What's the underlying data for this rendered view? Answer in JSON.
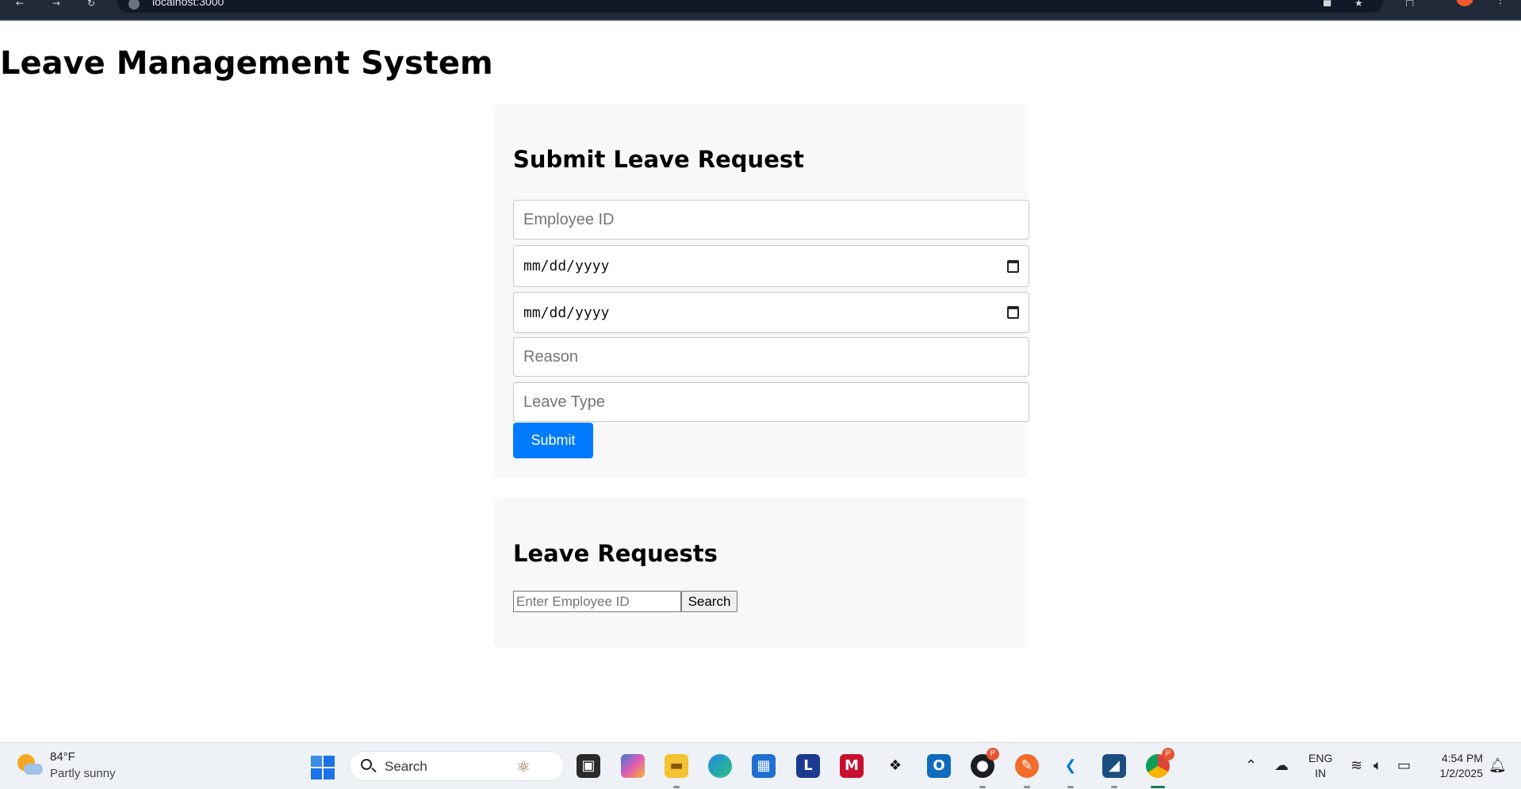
{
  "browser": {
    "url": "localhost:3000"
  },
  "page": {
    "title": "Leave Management System"
  },
  "submit_form": {
    "heading": "Submit Leave Request",
    "employee_id_placeholder": "Employee ID",
    "start_date_placeholder": "mm/dd/yyyy",
    "end_date_placeholder": "mm/dd/yyyy",
    "reason_placeholder": "Reason",
    "leave_type_placeholder": "Leave Type",
    "submit_label": "Submit"
  },
  "requests": {
    "heading": "Leave Requests",
    "search_placeholder": "Enter Employee ID",
    "search_label": "Search"
  },
  "taskbar": {
    "weather_temp": "84°F",
    "weather_desc": "Partly sunny",
    "search_label": "Search",
    "lang_line1": "ENG",
    "lang_line2": "IN",
    "time": "4:54 PM",
    "date": "1/2/2025",
    "badge_github": "P",
    "badge_chrome": "P"
  },
  "colors": {
    "accent": "#007bff",
    "card_bg": "#f8f8f8"
  }
}
